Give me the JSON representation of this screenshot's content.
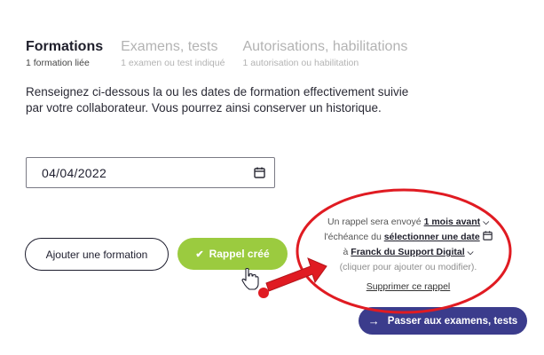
{
  "tabs": [
    {
      "title": "Formations",
      "subtitle": "1 formation liée",
      "active": true
    },
    {
      "title": "Examens, tests",
      "subtitle": "1 examen ou test indiqué",
      "active": false
    },
    {
      "title": "Autorisations, habilitations",
      "subtitle": "1 autorisation ou habilitation",
      "active": false
    }
  ],
  "intro": "Renseignez ci-dessous la ou les dates de formation effectivement suivie par votre collaborateur. Vous pourrez ainsi conserver un historique.",
  "date_field": {
    "value": "04/04/2022",
    "icon": "calendar-icon"
  },
  "buttons": {
    "add_training": "Ajouter une formation",
    "reminder_created": "Rappel créé",
    "next": "Passer aux examens, tests"
  },
  "reminder": {
    "line1_prefix": "Un rappel sera envoyé",
    "delay": "1 mois avant",
    "line2_prefix": "l'échéance du",
    "date_select": "sélectionner une date",
    "line3_prefix": "à",
    "recipient": "Franck du Support Digital",
    "hint": "(cliquer pour ajouter ou modifier).",
    "delete": "Supprimer ce rappel"
  },
  "colors": {
    "accent_green": "#9bcb3f",
    "primary_navy": "#3b3c8c",
    "annotation_red": "#e01b22"
  }
}
